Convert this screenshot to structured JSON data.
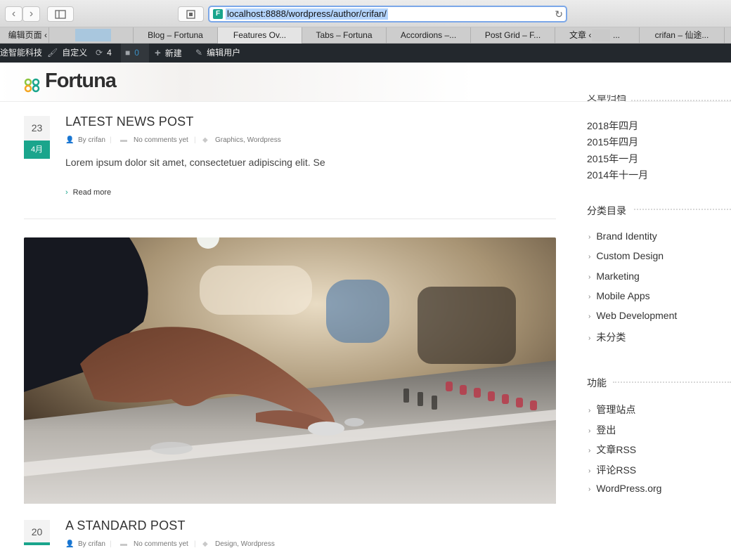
{
  "browser": {
    "back_icon": "chevron-left-icon",
    "forward_icon": "chevron-right-icon",
    "sidebar_icon": "sidebar-icon",
    "reader_icon": "reader-icon",
    "url": "localhost:8888/wordpress/author/crifan/",
    "favicon_letter": "F",
    "reload_icon": "reload-icon",
    "tabs": [
      {
        "label": "编辑页面 ‹"
      },
      {
        "label": ""
      },
      {
        "label": "Blog – Fortuna"
      },
      {
        "label": "Features Ov..."
      },
      {
        "label": "Tabs – Fortuna"
      },
      {
        "label": "Accordions –..."
      },
      {
        "label": "Post Grid – F..."
      },
      {
        "label": "文章 ‹"
      },
      {
        "label": "crifan – 仙途..."
      }
    ]
  },
  "adminbar": {
    "site_name": "途智能科技",
    "customize": "自定义",
    "updates_count": "4",
    "comments_count": "0",
    "new": "新建",
    "edit_user": "编辑用户"
  },
  "header": {
    "logo_text": "Fortuna"
  },
  "posts": [
    {
      "day": "23",
      "month": "4月",
      "title": "LATEST NEWS POST",
      "author": "By crifan",
      "comments": "No comments yet",
      "categories": "Graphics, Wordpress",
      "excerpt": "Lorem ipsum dolor sit amet, consectetuer adipiscing elit. Se",
      "read_more": "Read more"
    },
    {
      "day": "20",
      "title": "A STANDARD POST",
      "author": "By crifan",
      "comments": "No comments yet",
      "categories": "Design, Wordpress"
    }
  ],
  "sidebar": {
    "archives_title": "文章归档",
    "archives": [
      "2018年四月",
      "2015年四月",
      "2015年一月",
      "2014年十一月"
    ],
    "categories_title": "分类目录",
    "categories": [
      "Brand Identity",
      "Custom Design",
      "Marketing",
      "Mobile Apps",
      "Web Development",
      "未分类"
    ],
    "meta_title": "功能",
    "meta_links": [
      "管理站点",
      "登出",
      "文章RSS",
      "评论RSS",
      "WordPress.org"
    ]
  },
  "colors": {
    "accent": "#1aa58c",
    "adminbar": "#23282d",
    "url_highlight": "#b3d4fc"
  }
}
